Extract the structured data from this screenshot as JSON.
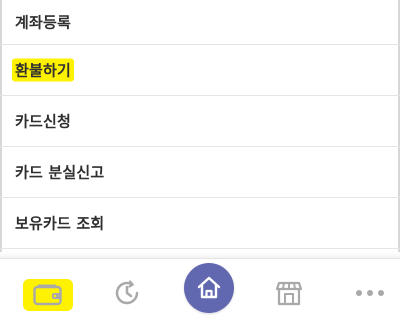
{
  "menu": {
    "items": [
      {
        "label": "계좌등록",
        "highlighted": false
      },
      {
        "label": "환불하기",
        "highlighted": true
      },
      {
        "label": "카드신청",
        "highlighted": false
      },
      {
        "label": "카드 분실신고",
        "highlighted": false
      },
      {
        "label": "보유카드 조회",
        "highlighted": false
      }
    ]
  },
  "bottom_nav": {
    "items": [
      {
        "icon": "wallet-icon",
        "active": true
      },
      {
        "icon": "history-icon",
        "active": false
      },
      {
        "icon": "home-icon",
        "active": false
      },
      {
        "icon": "store-icon",
        "active": false
      },
      {
        "icon": "more-icon",
        "active": false
      }
    ]
  },
  "colors": {
    "highlight": "#fff200",
    "home_button": "#6168b0",
    "icon_gray": "#a9a9a9",
    "text": "#2f2f2f",
    "divider": "#e5e5e5"
  }
}
